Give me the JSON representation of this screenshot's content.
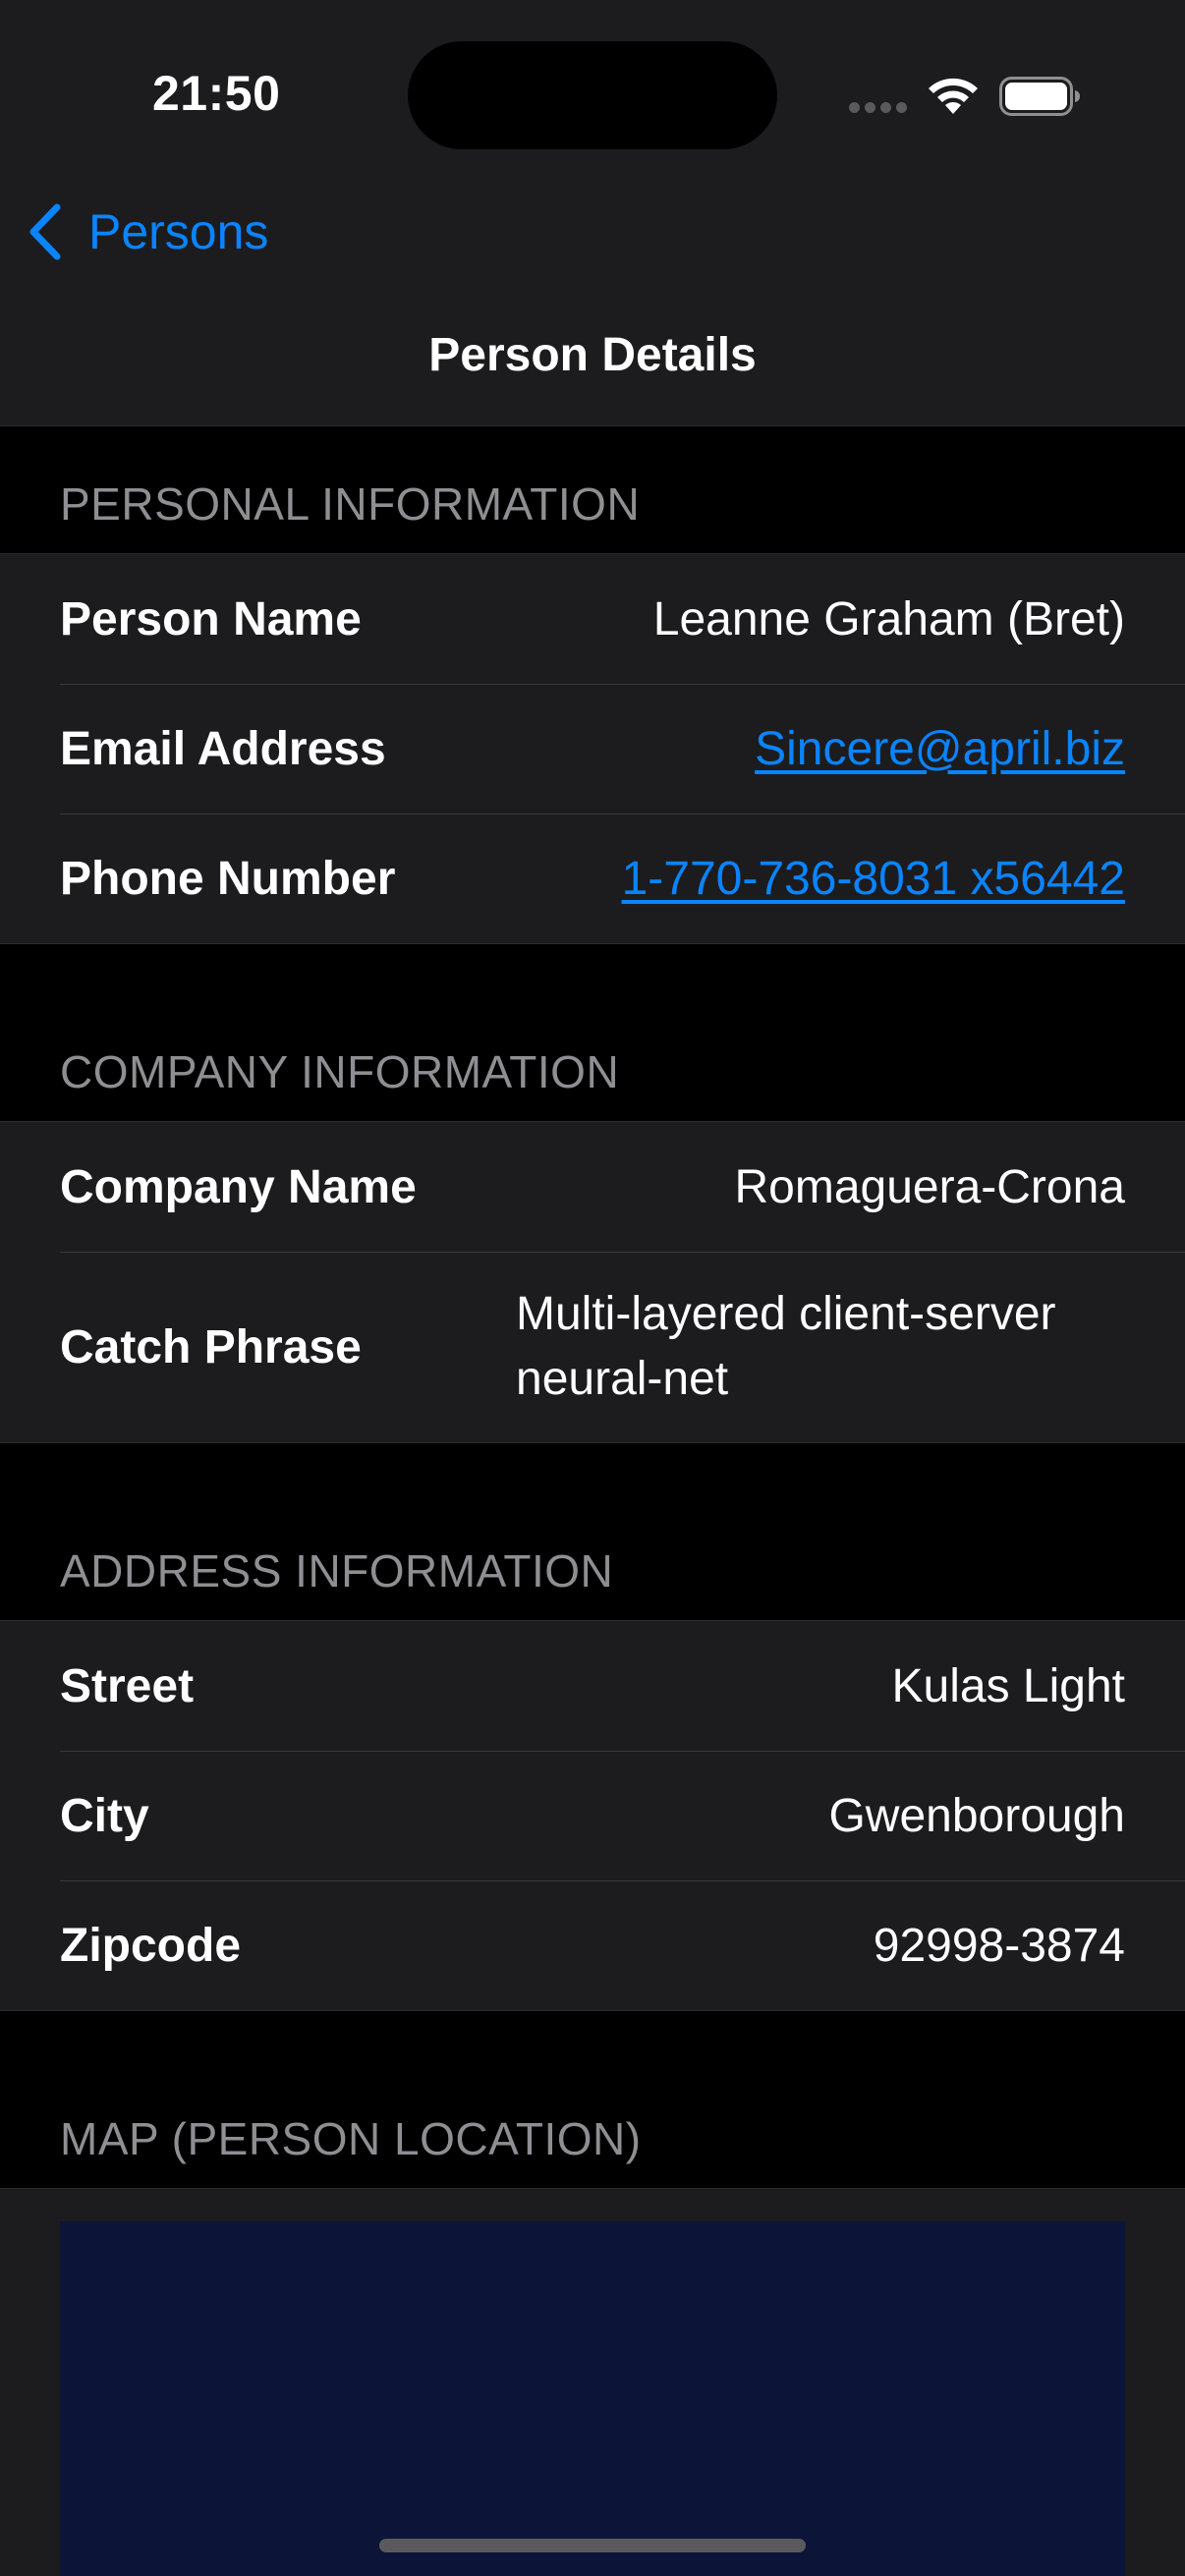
{
  "status": {
    "time": "21:50"
  },
  "nav": {
    "back_label": "Persons",
    "title": "Person Details"
  },
  "personal": {
    "header": "PERSONAL INFORMATION",
    "rows": [
      {
        "label": "Person Name",
        "value": "Leanne Graham (Bret)"
      },
      {
        "label": "Email Address",
        "value": "Sincere@april.biz"
      },
      {
        "label": "Phone Number",
        "value": "1-770-736-8031 x56442"
      }
    ]
  },
  "company": {
    "header": "COMPANY INFORMATION",
    "rows": [
      {
        "label": "Company Name",
        "value": "Romaguera-Crona"
      },
      {
        "label": "Catch Phrase",
        "value": "Multi-layered client-server neural-net"
      }
    ]
  },
  "address": {
    "header": "ADDRESS INFORMATION",
    "rows": [
      {
        "label": "Street",
        "value": "Kulas Light"
      },
      {
        "label": "City",
        "value": "Gwenborough"
      },
      {
        "label": "Zipcode",
        "value": "92998-3874"
      }
    ]
  },
  "map": {
    "header": "MAP (PERSON LOCATION)"
  },
  "colors": {
    "accent": "#0a84ff",
    "background": "#000000",
    "cell": "#1c1c1e",
    "secondary_text": "#8e8e93",
    "map": "#0c1438"
  },
  "icons": {
    "back": "chevron-left-icon",
    "wifi": "wifi-icon",
    "battery": "battery-icon",
    "signal": "cellular-signal-icon"
  }
}
